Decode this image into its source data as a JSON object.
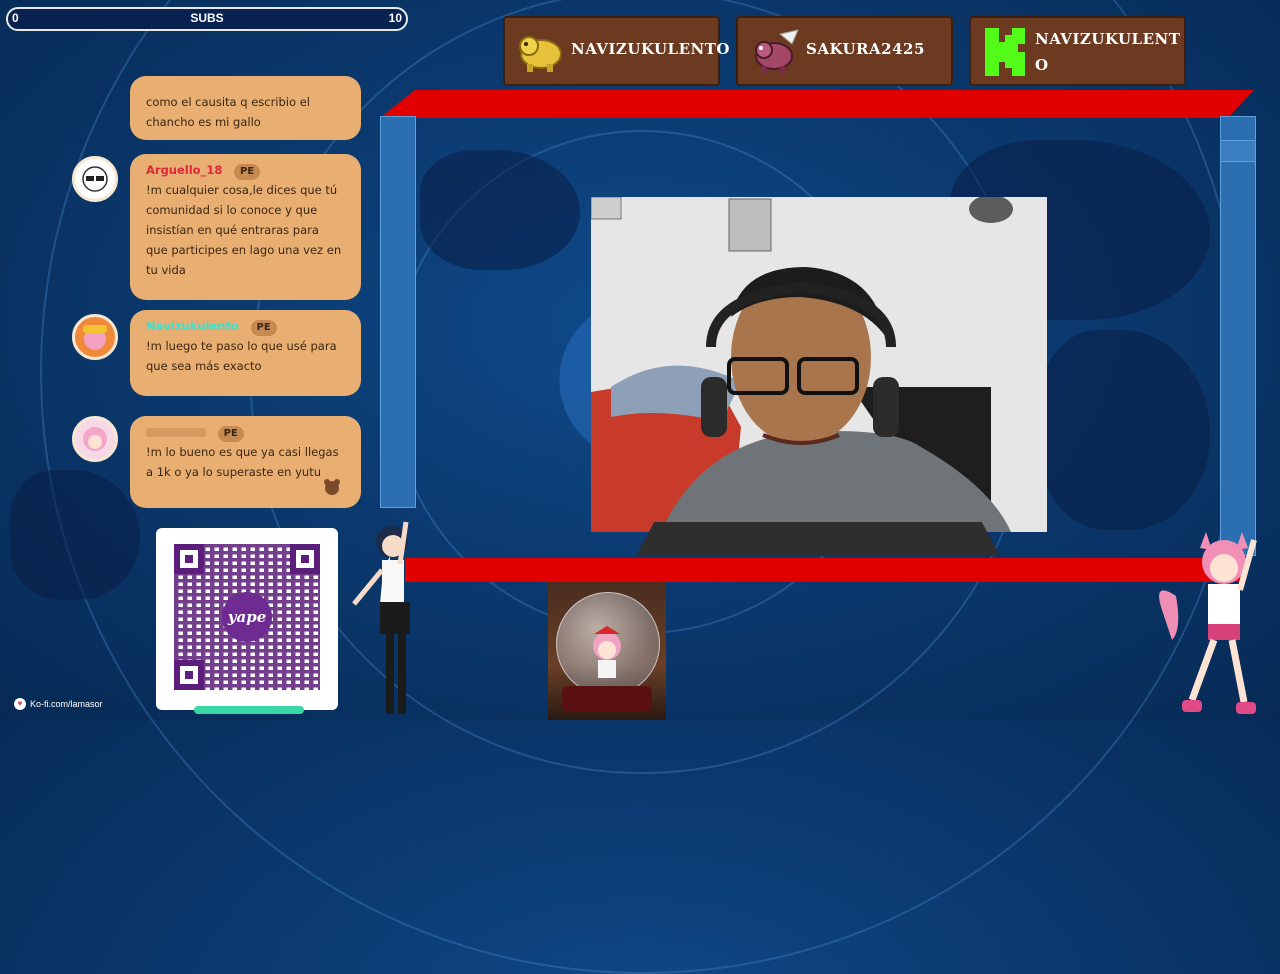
{
  "subs_bar": {
    "min": "0",
    "title": "SUBS",
    "max": "10",
    "fill_fraction": 0
  },
  "donors": [
    {
      "name": "NAVIZUKULENTO"
    },
    {
      "name": "SAKURA2425"
    },
    {
      "name": "NAVIZUKULENTO"
    }
  ],
  "chat": {
    "messages": [
      {
        "user": "",
        "badge": "",
        "text": "como el causita q escribio el\nchancho es mi gallo"
      },
      {
        "user": "Arguello_18",
        "user_color": "#e0283a",
        "badge": "PE",
        "text": "!m cualquier cosa,le dices que tú\ncomunidad si lo conoce y que\ninsistían en qué entraras para\nque participes en lago una vez en\ntu vida"
      },
      {
        "user": "Navizukulento",
        "user_color": "#3fe0d0",
        "badge": "PE",
        "text": "!m luego te paso lo que usé para\nque sea más exacto"
      },
      {
        "user": "",
        "badge": "PE",
        "text": "!m lo bueno es que ya casi llegas\na 1k o ya lo superaste en yutu"
      }
    ]
  },
  "qr": {
    "brand": "yape"
  },
  "kofi": {
    "url": "Ko-fi.com/lamasor"
  },
  "colors": {
    "chat_bubble": "#e9ae72",
    "frame_red": "#e00000",
    "donor_box": "#6b3a21"
  }
}
